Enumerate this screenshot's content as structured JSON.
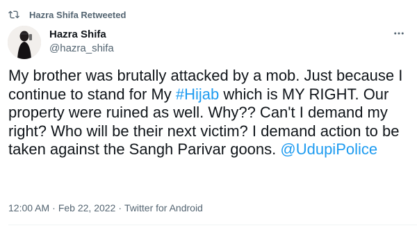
{
  "retweet": {
    "label": "Hazra Shifa Retweeted"
  },
  "author": {
    "display_name": "Hazra Shifa",
    "handle": "@hazra_shifa"
  },
  "tweet": {
    "text_part1": "My brother was brutally attacked by a mob. Just because I continue to stand for My ",
    "hashtag": "#Hijab",
    "text_part2": " which is MY RIGHT. Our property were ruined as well. Why?? Can't I demand my right? Who will be their next victim? I demand action to be taken against the Sangh Parivar goons. ",
    "mention": "@UdupiPolice"
  },
  "meta": {
    "time": "12:00 AM",
    "separator1": "·",
    "date": "Feb 22, 2022",
    "separator2": "·",
    "source": "Twitter for Android"
  },
  "icons": {
    "retweet": "retweet-icon",
    "more": "more-icon",
    "avatar": "avatar"
  },
  "colors": {
    "link": "#1d9bf0",
    "secondary_text": "#536471",
    "primary_text": "#0f1419"
  }
}
